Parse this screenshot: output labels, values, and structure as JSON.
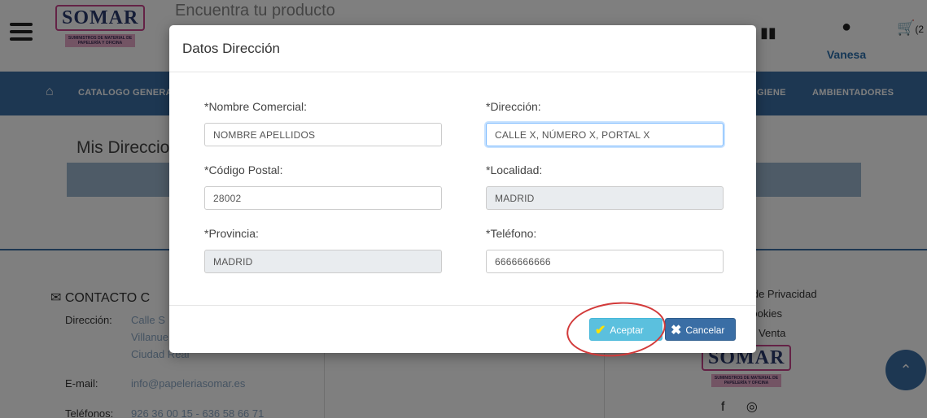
{
  "header": {
    "logo": "SOMAR",
    "logo_subtitle": "SUMINISTROS DE MATERIAL DE PAPELERÍA Y OFICINA",
    "search_placeholder": "Encuentra tu producto",
    "user_name": "Vanesa",
    "cart_count": "(2"
  },
  "nav": {
    "items": [
      "CATALOGO GENERA",
      "GIENE",
      "AMBIENTADORES"
    ]
  },
  "page": {
    "title": "Mis Direccio"
  },
  "footer": {
    "contact_title": "CONTACTO C",
    "address_label": "Dirección:",
    "address_lines": [
      "Calle S",
      "Villanue",
      "Ciudad Real"
    ],
    "email_label": "E-mail:",
    "email": "info@papeleriasomar.es",
    "phones_label": "Teléfonos:",
    "phones": "926 36 00 15 - 636 58 66 71",
    "legal_links": [
      "a de Privacidad",
      "Cookies",
      "de Venta"
    ]
  },
  "modal": {
    "title": "Datos Dirección",
    "fields": [
      {
        "label": "*Nombre Comercial:",
        "value": "NOMBRE APELLIDOS",
        "disabled": false
      },
      {
        "label": "*Dirección:",
        "value": "CALLE X, NÚMERO X, PORTAL X",
        "disabled": false,
        "focused": true
      },
      {
        "label": "*Código Postal:",
        "value": "28002",
        "disabled": false
      },
      {
        "label": "*Localidad:",
        "value": "MADRID",
        "disabled": true
      },
      {
        "label": "*Provincia:",
        "value": "MADRID",
        "disabled": true
      },
      {
        "label": "*Teléfono:",
        "value": "6666666666",
        "disabled": false
      }
    ],
    "accept_label": "Aceptar",
    "cancel_label": "Cancelar"
  },
  "colors": {
    "brand_blue": "#3a6ea5",
    "accept_button": "#5bc0de",
    "highlight_ring": "#d23a3a"
  }
}
